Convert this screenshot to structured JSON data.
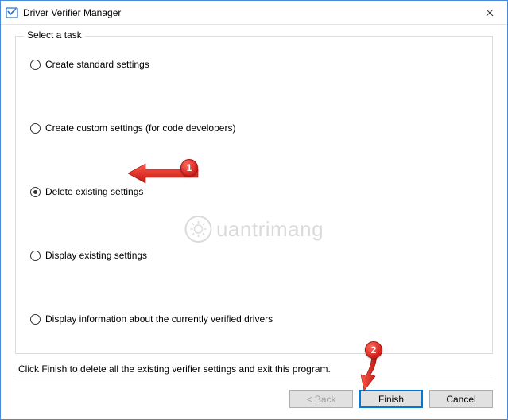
{
  "window": {
    "title": "Driver Verifier Manager"
  },
  "group": {
    "legend": "Select a task"
  },
  "options": {
    "o0": "Create standard settings",
    "o1": "Create custom settings (for code developers)",
    "o2": "Delete existing settings",
    "o3": "Display existing settings",
    "o4": "Display information about the currently verified drivers",
    "selected_index": 2
  },
  "hint": "Click Finish to delete all the existing verifier settings and exit this program.",
  "buttons": {
    "back": "< Back",
    "finish": "Finish",
    "cancel": "Cancel"
  },
  "annotations": {
    "badge1": "1",
    "badge2": "2"
  },
  "watermark": {
    "text": "uantrimang"
  }
}
